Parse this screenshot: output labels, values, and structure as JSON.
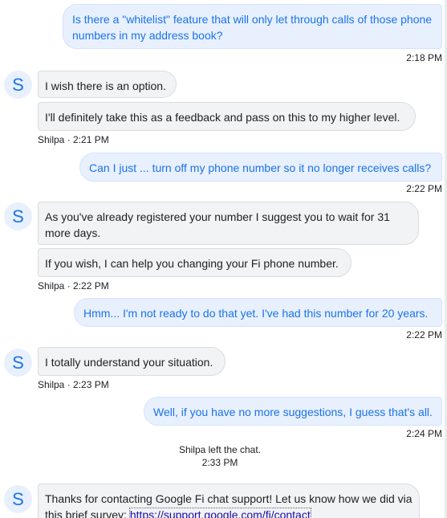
{
  "messages": {
    "m1": {
      "text": "Is there a \"whitelist\" feature that will only let through calls of those phone numbers in my address book?",
      "time": "2:18 PM"
    },
    "m2": {
      "lines": [
        "I wish there is an option.",
        "I'll definitely take this as a feedback and pass on this to my higher level."
      ],
      "sender_time": "Shilpa · 2:21 PM"
    },
    "m3": {
      "text": "Can I just ... turn off my phone number so it no longer receives calls?",
      "time": "2:22 PM"
    },
    "m4": {
      "lines": [
        "As you've already registered your number I suggest you to wait for 31 more days.",
        "If you wish, I can help you changing your Fi phone number."
      ],
      "sender_time": "Shilpa · 2:22 PM"
    },
    "m5": {
      "text": "Hmm... I'm not ready to do that yet.  I've had this number for 20 years.",
      "time": "2:22 PM"
    },
    "m6": {
      "lines": [
        "I totally understand your situation."
      ],
      "sender_time": "Shilpa · 2:23 PM"
    },
    "m7": {
      "text": "Well, if you have no more suggestions, I guess that's all.",
      "time": "2:24 PM"
    },
    "system": {
      "text": "Shilpa left the chat.",
      "time": "2:33 PM"
    },
    "m8": {
      "text_before_link": "Thanks for contacting Google Fi chat support! Let us know how we did via this brief survey: ",
      "link": "https://support.google.com/fi/contact"
    }
  },
  "agent": {
    "avatar_letter": "S"
  },
  "colors": {
    "outgoing_bg": "#e8f0fe",
    "outgoing_text": "#1a73e8",
    "incoming_bg": "#f1f3f4",
    "incoming_text": "#202124"
  }
}
